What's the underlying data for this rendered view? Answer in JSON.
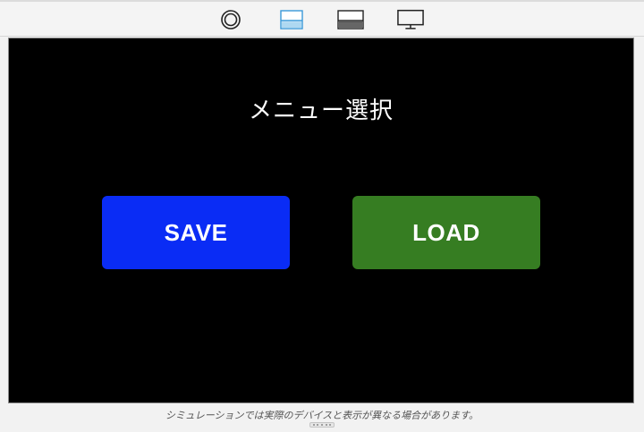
{
  "toolbar": {
    "buttons": [
      {
        "icon": "concentric-circle-icon"
      },
      {
        "icon": "split-top-icon",
        "active": true,
        "accent": "#3a9ad9"
      },
      {
        "icon": "split-bottom-icon"
      },
      {
        "icon": "monitor-icon"
      }
    ]
  },
  "screen": {
    "title": "メニュー選択",
    "save_label": "SAVE",
    "load_label": "LOAD",
    "colors": {
      "background": "#000000",
      "save": "#0a2cf5",
      "load": "#367d22",
      "text": "#ffffff"
    }
  },
  "footer": {
    "disclaimer": "シミュレーションでは実際のデバイスと表示が異なる場合があります。"
  }
}
